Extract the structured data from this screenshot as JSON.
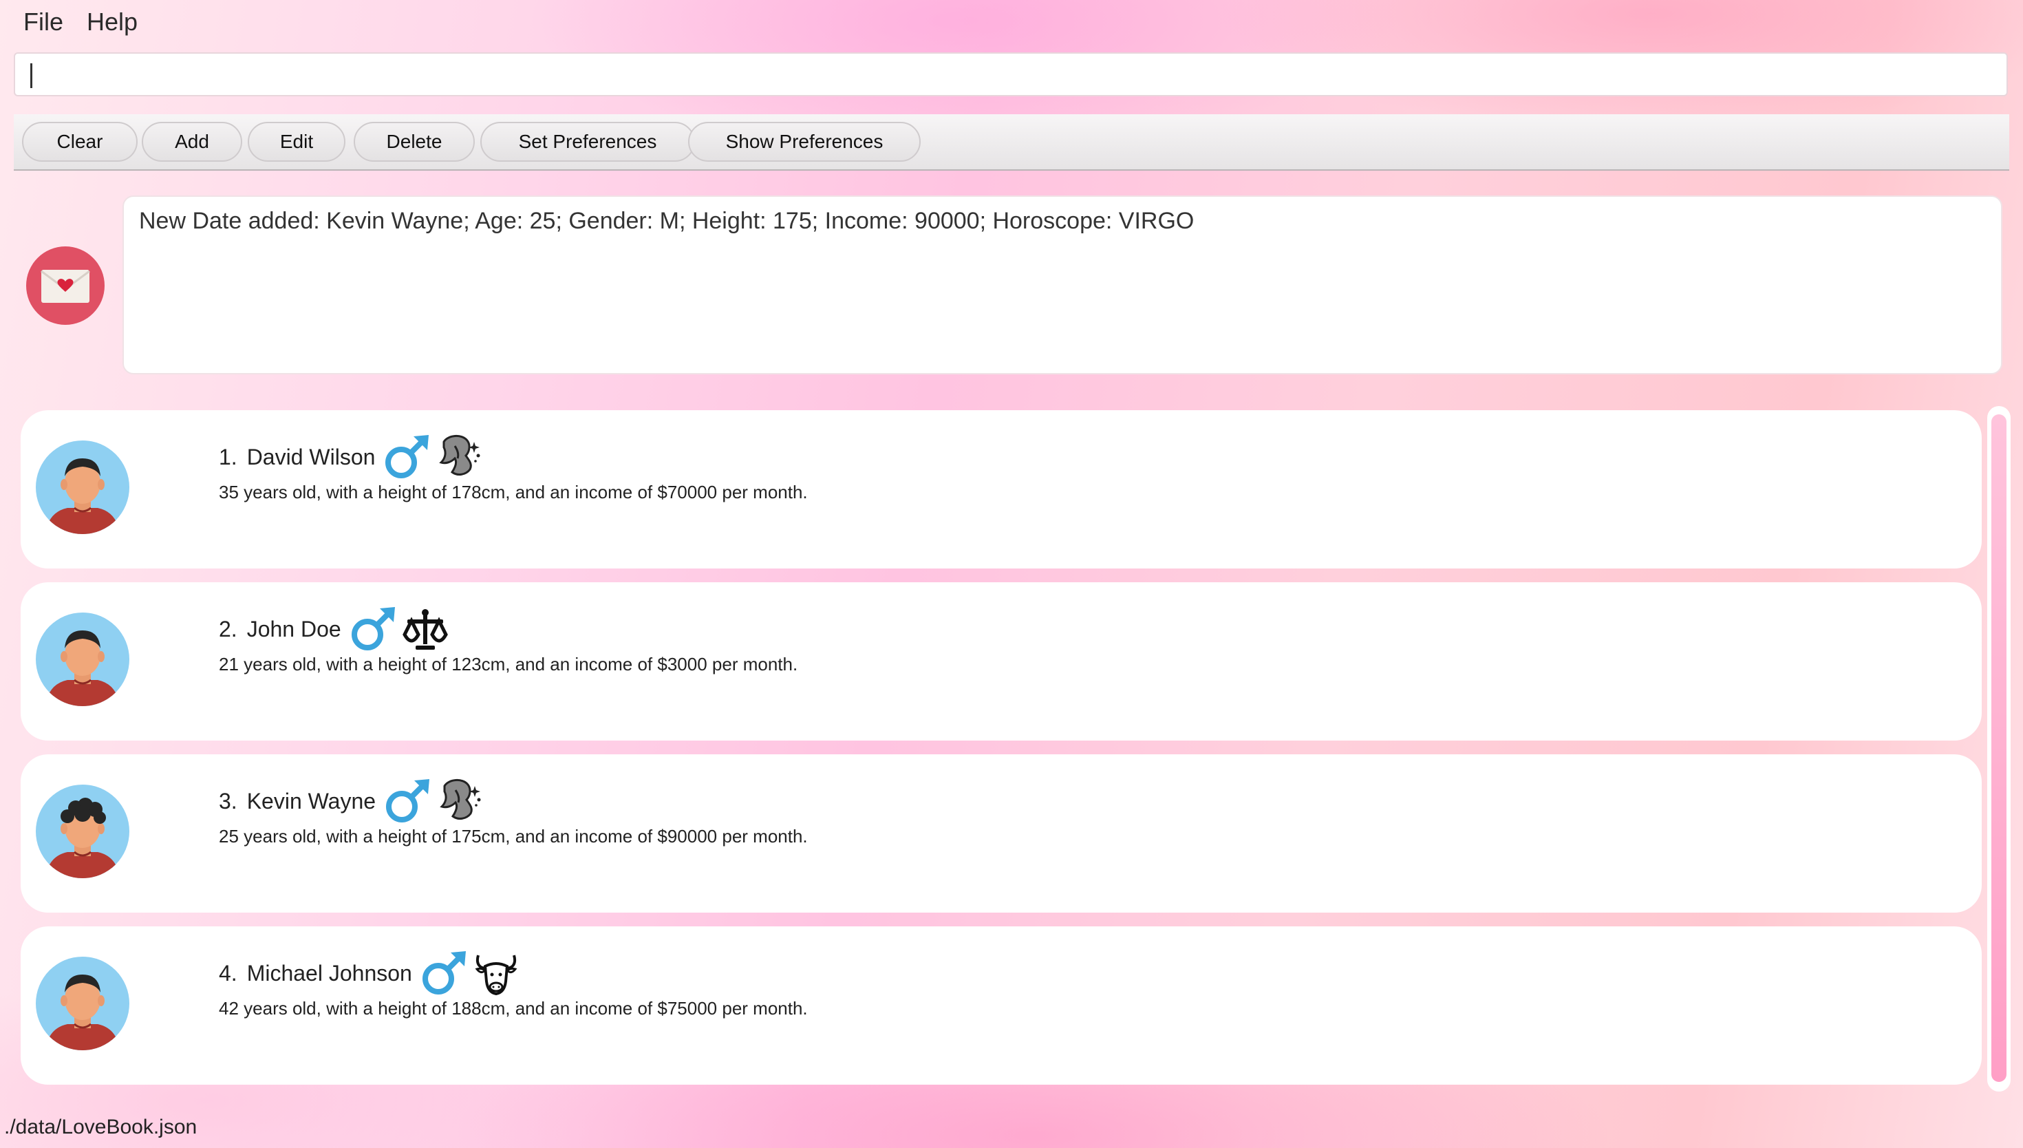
{
  "menu": {
    "file": "File",
    "help": "Help"
  },
  "command": {
    "value": "",
    "placeholder": ""
  },
  "toolbar": {
    "clear": "Clear",
    "add": "Add",
    "edit": "Edit",
    "delete": "Delete",
    "set_preferences": "Set Preferences",
    "show_preferences": "Show Preferences"
  },
  "logo_icon": "envelope-heart-icon",
  "result": "New Date added: Kevin Wayne; Age: 25; Gender: M; Height: 175; Income: 90000; Horoscope: VIRGO",
  "dates": [
    {
      "index": "1.",
      "name": "David Wilson",
      "gender_icon": "male-icon",
      "zodiac_icon": "virgo-icon",
      "description": "35 years old, with a height of 178cm, and an income of $70000 per month."
    },
    {
      "index": "2.",
      "name": "John Doe",
      "gender_icon": "male-icon",
      "zodiac_icon": "libra-icon",
      "description": "21 years old, with a height of 123cm, and an income of $3000 per month."
    },
    {
      "index": "3.",
      "name": "Kevin Wayne",
      "gender_icon": "male-icon",
      "zodiac_icon": "virgo-icon",
      "description": "25 years old, with a height of 175cm, and an income of $90000 per month."
    },
    {
      "index": "4.",
      "name": "Michael Johnson",
      "gender_icon": "male-icon",
      "zodiac_icon": "taurus-icon",
      "description": "42 years old, with a height of 188cm, and an income of $75000 per month."
    }
  ],
  "status": "./data/LoveBook.json",
  "colors": {
    "accent": "#e05064",
    "male": "#3ba4dc",
    "avatar_bg": "#8fd0f2",
    "shirt": "#b43a32"
  }
}
